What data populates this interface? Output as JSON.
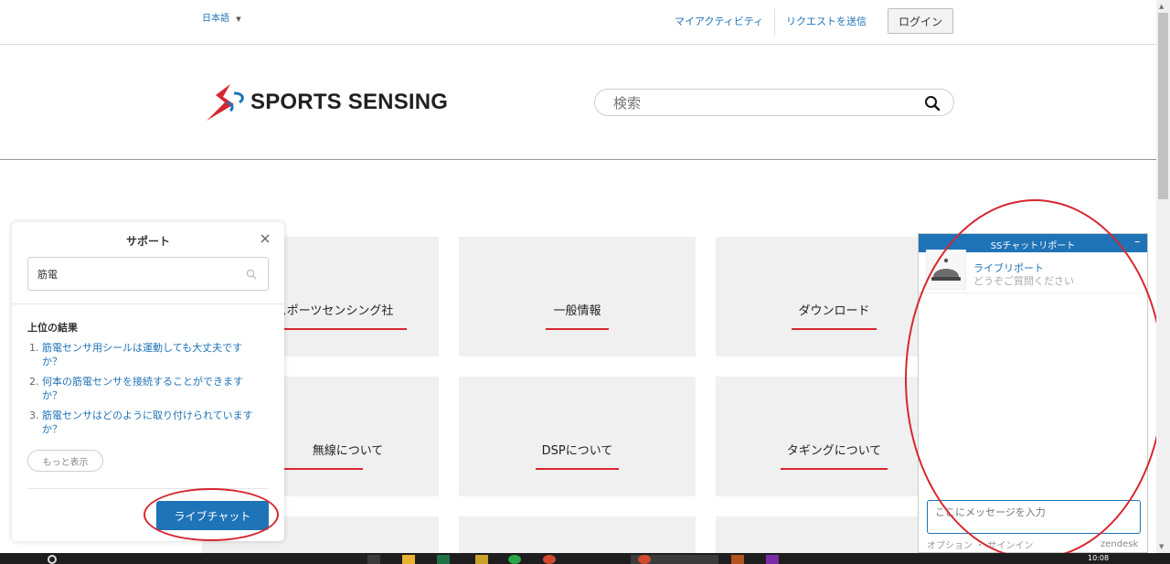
{
  "header": {
    "language": "日本語",
    "language_caret": "▼",
    "nav": {
      "my_activity": "マイアクティビティ",
      "submit_request": "リクエストを送信",
      "login": "ログイン"
    }
  },
  "brand": {
    "name": "SPORTS SENSING",
    "colors": {
      "red": "#d7262f",
      "blue": "#1f73b7"
    }
  },
  "search": {
    "placeholder": "検索"
  },
  "tiles": [
    {
      "label": "スポーツセンシング社"
    },
    {
      "label": "一般情報"
    },
    {
      "label": "ダウンロード"
    },
    {
      "label": "無線について"
    },
    {
      "label": "DSPについて"
    },
    {
      "label": "タギングについて"
    }
  ],
  "support_widget": {
    "title": "サポート",
    "search_value": "筋電",
    "results_heading": "上位の結果",
    "results": [
      {
        "num": "1.",
        "text": "筋電センサ用シールは運動しても大丈夫ですか？"
      },
      {
        "num": "2.",
        "text": "何本の筋電センサを接続することができますか？"
      },
      {
        "num": "3.",
        "text": "筋電センサはどのように取り付けられていますか？"
      }
    ],
    "more_button": "もっと表示",
    "live_chat_button": "ライブチャット"
  },
  "chat_window": {
    "title": "SSチャットリポート",
    "minimize": "–",
    "agent_name": "ライブリポート",
    "agent_subtitle": "どうぞご質問ください",
    "input_placeholder": "ここにメッセージを入力",
    "options": "オプション ・ サインイン",
    "branding": "zendesk"
  },
  "taskbar": {
    "clock": "10:08"
  },
  "annotation_color": "#d7262f"
}
